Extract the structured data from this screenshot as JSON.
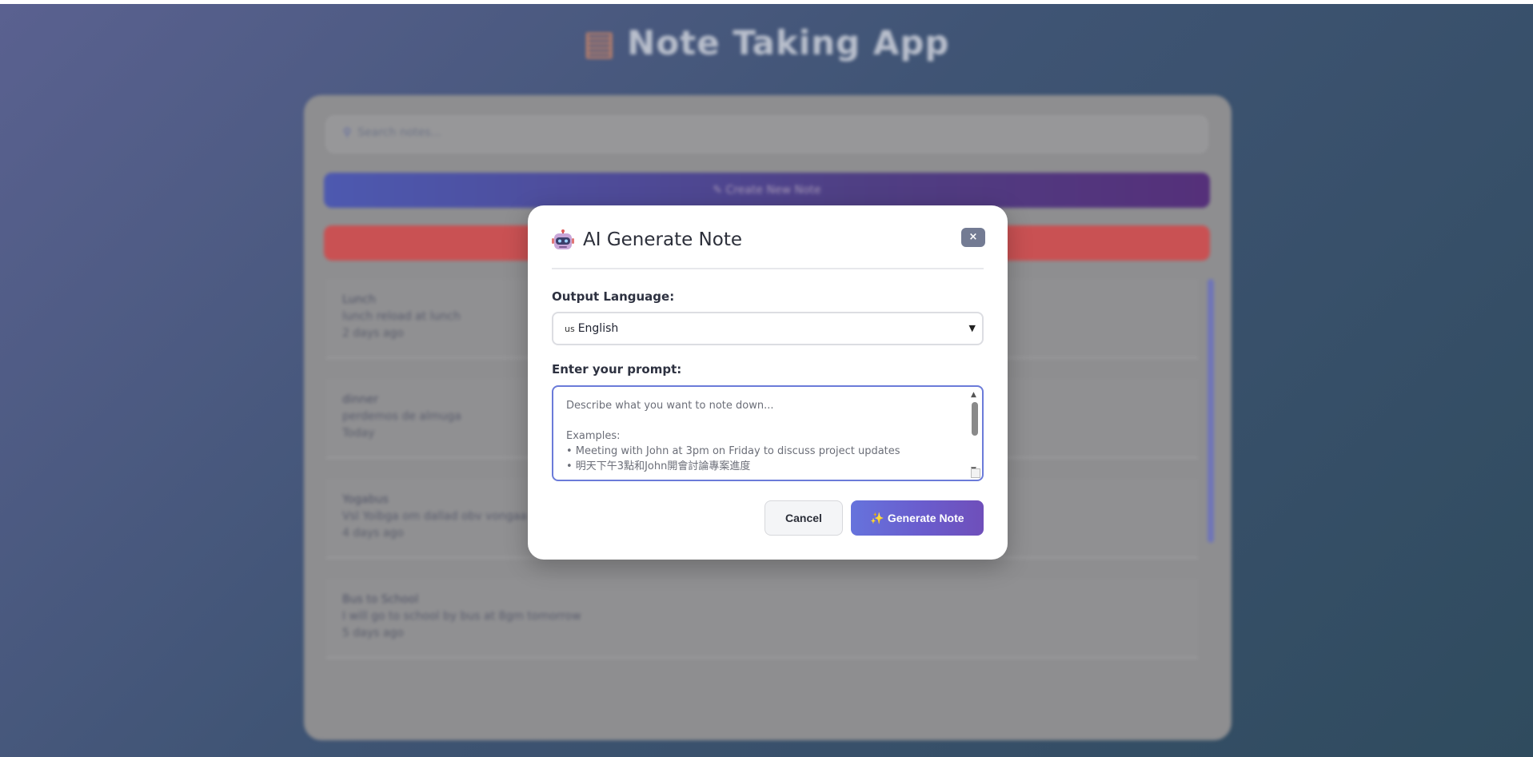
{
  "app": {
    "title": "Note Taking App",
    "search_placeholder": "Search notes...",
    "create_button": "Create New Note",
    "notes": [
      {
        "title": "Lunch",
        "body": "lunch reload at lunch",
        "date": "2 days ago"
      },
      {
        "title": "dinner",
        "body": "perdemos de almuga",
        "date": "Today"
      },
      {
        "title": "Yogabus",
        "body": "Vsl Yoibga om dallad obv vongaa",
        "date": "4 days ago"
      },
      {
        "title": "Bus to School",
        "body": "I will go to school by bus at 8gm tomorrow",
        "date": "5 days ago"
      }
    ]
  },
  "modal": {
    "title": "AI Generate Note",
    "close_label": "×",
    "language_label": "Output Language:",
    "language_flag": "us",
    "language_value": "English",
    "prompt_label": "Enter your prompt:",
    "prompt_placeholder_lines": [
      "Describe what you want to note down...",
      "",
      "Examples:",
      "• Meeting with John at 3pm on Friday to discuss project updates",
      "• 明天下午3點和John開會討論專案進度"
    ],
    "cancel_label": "Cancel",
    "generate_label": "Generate Note",
    "generate_icon": "✨"
  },
  "colors": {
    "accent": "#6b7bd9",
    "close_button": "#737b93",
    "generate_gradient_start": "#6673dc",
    "generate_gradient_end": "#6f4fba"
  }
}
